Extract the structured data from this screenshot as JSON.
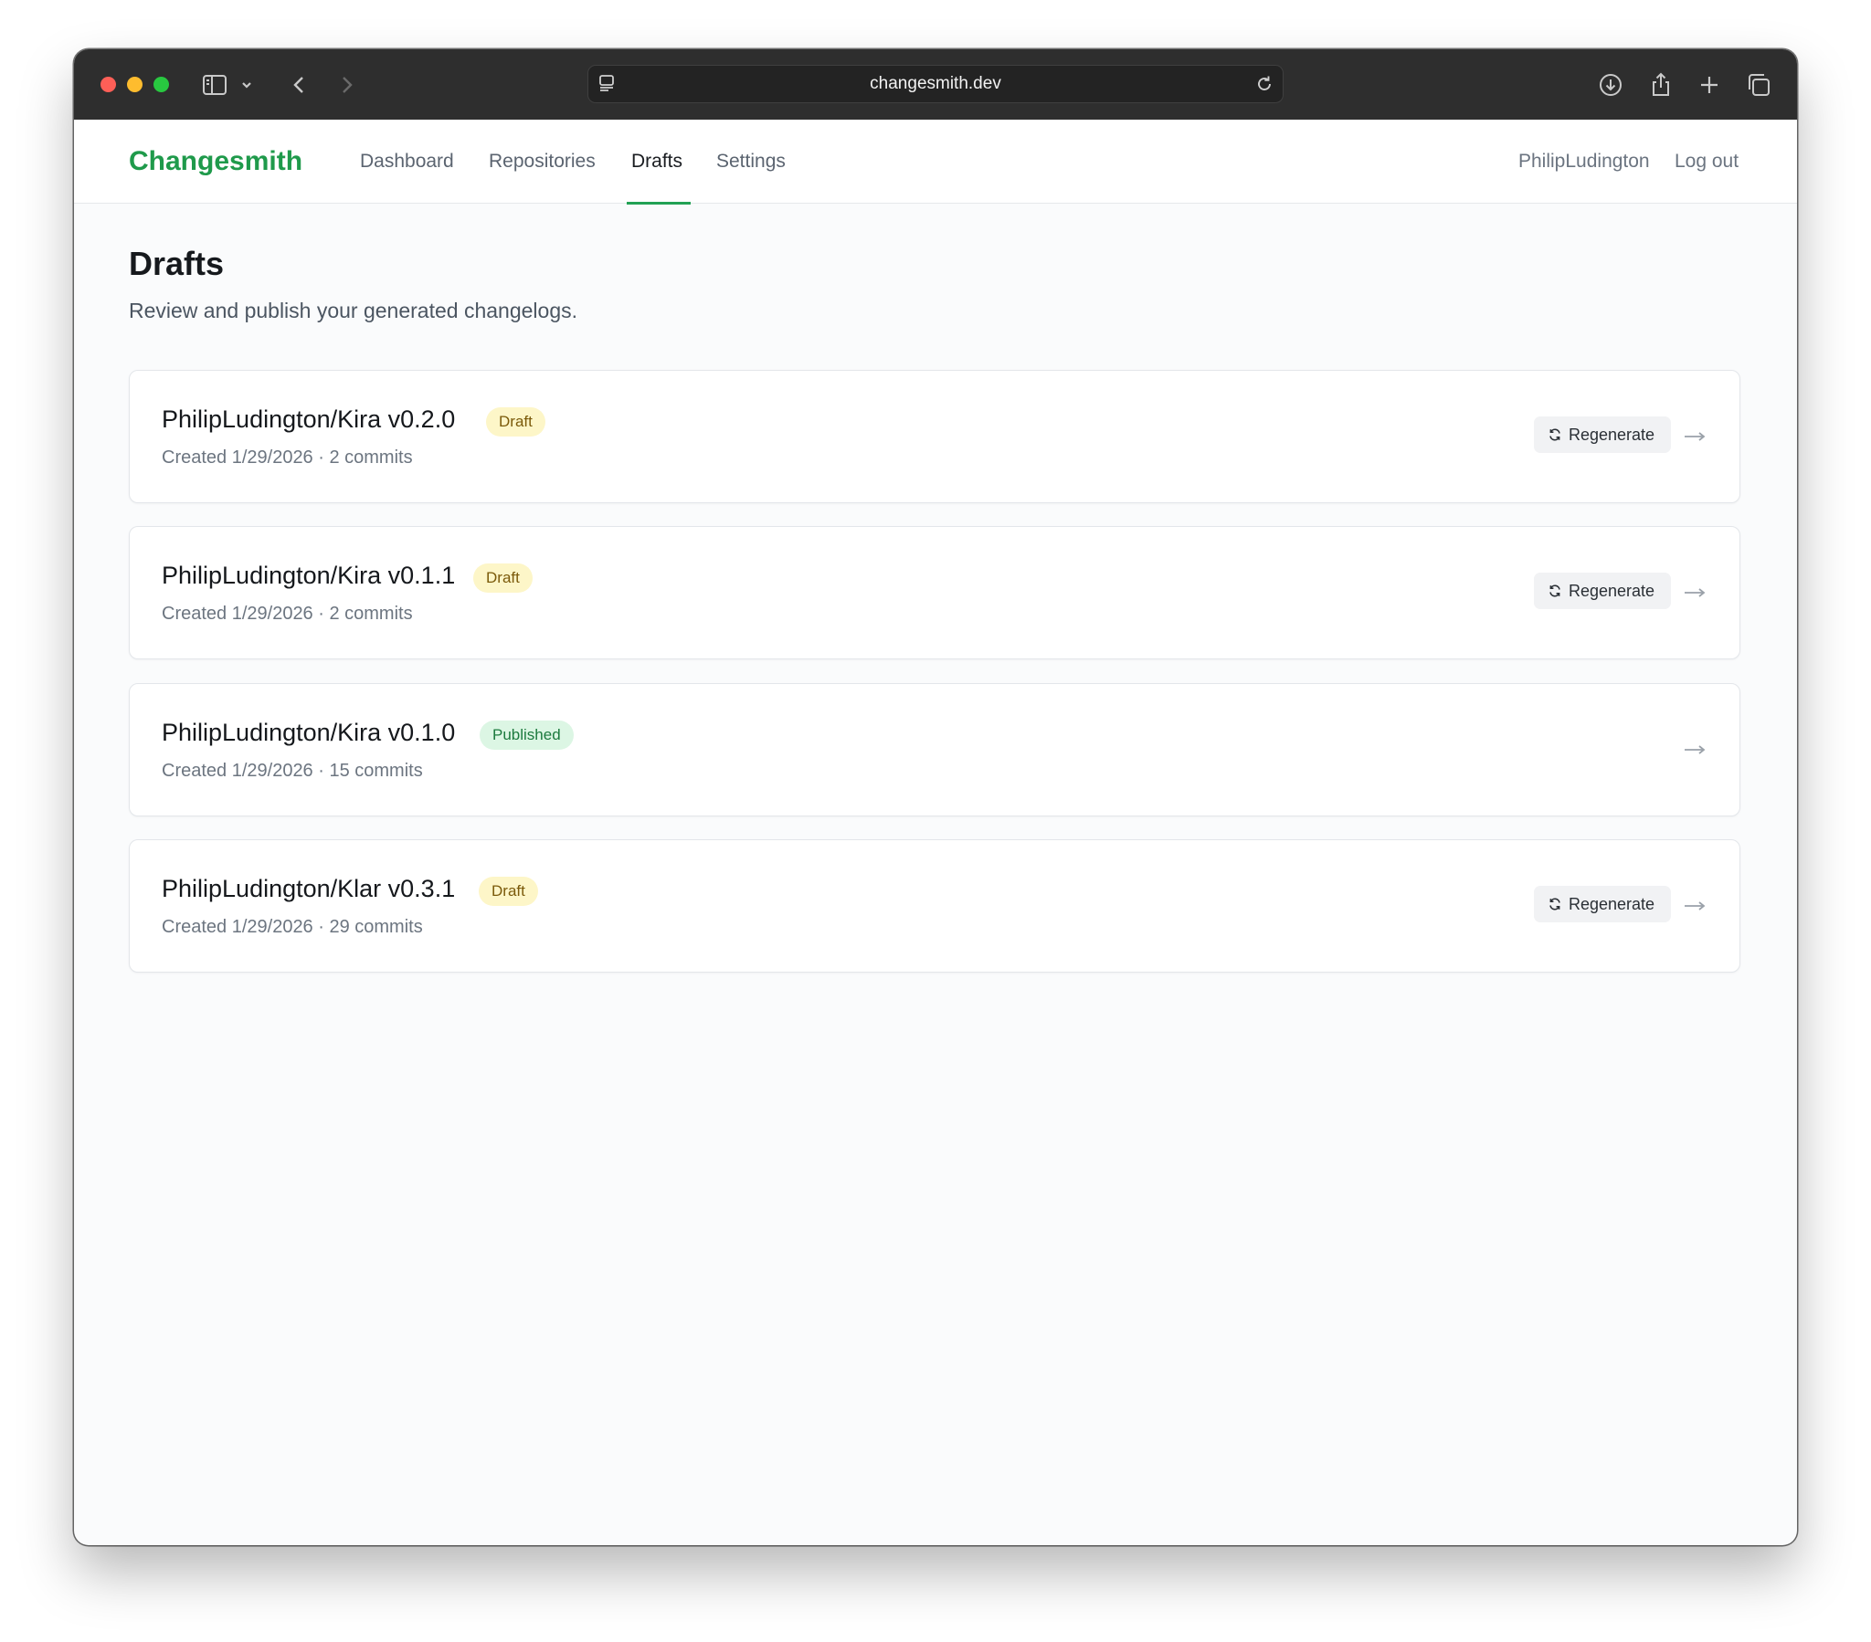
{
  "browser": {
    "url": "changesmith.dev"
  },
  "app": {
    "brand": "Changesmith",
    "nav": [
      {
        "label": "Dashboard",
        "active": false
      },
      {
        "label": "Repositories",
        "active": false
      },
      {
        "label": "Drafts",
        "active": true
      },
      {
        "label": "Settings",
        "active": false
      }
    ],
    "user": "PhilipLudington",
    "logout": "Log out",
    "accent_color": "#1f9a4b"
  },
  "page": {
    "title": "Drafts",
    "subtitle": "Review and publish your generated changelogs."
  },
  "drafts": [
    {
      "title": "PhilipLudington/Kira v0.2.0",
      "status": "Draft",
      "meta": "Created 1/29/2026 · 2 commits",
      "regenerate": "Regenerate",
      "has_regenerate": true
    },
    {
      "title": "PhilipLudington/Kira v0.1.1",
      "status": "Draft",
      "meta": "Created 1/29/2026 · 2 commits",
      "regenerate": "Regenerate",
      "has_regenerate": true
    },
    {
      "title": "PhilipLudington/Kira v0.1.0",
      "status": "Published",
      "meta": "Created 1/29/2026 · 15 commits",
      "regenerate": "",
      "has_regenerate": false
    },
    {
      "title": "PhilipLudington/Klar v0.3.1",
      "status": "Draft",
      "meta": "Created 1/29/2026 · 29 commits",
      "regenerate": "Regenerate",
      "has_regenerate": true
    }
  ]
}
